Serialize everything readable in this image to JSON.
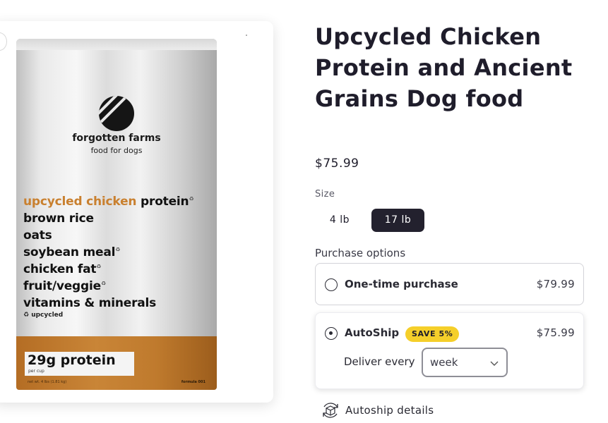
{
  "product": {
    "title": "Upcycled Chicken Protein and Ancient Grains Dog food",
    "price": "$75.99"
  },
  "bag": {
    "brand": "forgotten farms",
    "tagline": "food for dogs",
    "ingredients": [
      {
        "highlight": "upcycled chicken",
        "rest": " protein"
      },
      {
        "highlight": "",
        "rest": "brown rice"
      },
      {
        "highlight": "",
        "rest": "oats"
      },
      {
        "highlight": "",
        "rest": "soybean meal"
      },
      {
        "highlight": "",
        "rest": "chicken fat"
      },
      {
        "highlight": "",
        "rest": "fruit/veggie"
      },
      {
        "highlight": "",
        "rest": "vitamins & minerals"
      }
    ],
    "upcycled_note": "upcycled",
    "protein": "29g protein",
    "per_cup": "per cup",
    "net_weight": "net wt. 4 lbs (1.81 kg)",
    "formula": "formula 001",
    "colors": {
      "accent": "#c9802f",
      "bottom": "#c4802f"
    }
  },
  "size": {
    "label": "Size",
    "options": [
      "4 lb",
      "17 lb"
    ],
    "selected": "17 lb"
  },
  "purchase": {
    "label": "Purchase options",
    "one_time": {
      "label": "One-time purchase",
      "price": "$79.99",
      "selected": false
    },
    "autoship": {
      "label": "AutoShip",
      "badge": "SAVE 5%",
      "price": "$75.99",
      "selected": true,
      "deliver_label": "Deliver every",
      "frequency": "week"
    }
  },
  "autoship_details": "Autoship details",
  "colors": {
    "dark": "#23212e",
    "badge": "#f5cf2a"
  }
}
